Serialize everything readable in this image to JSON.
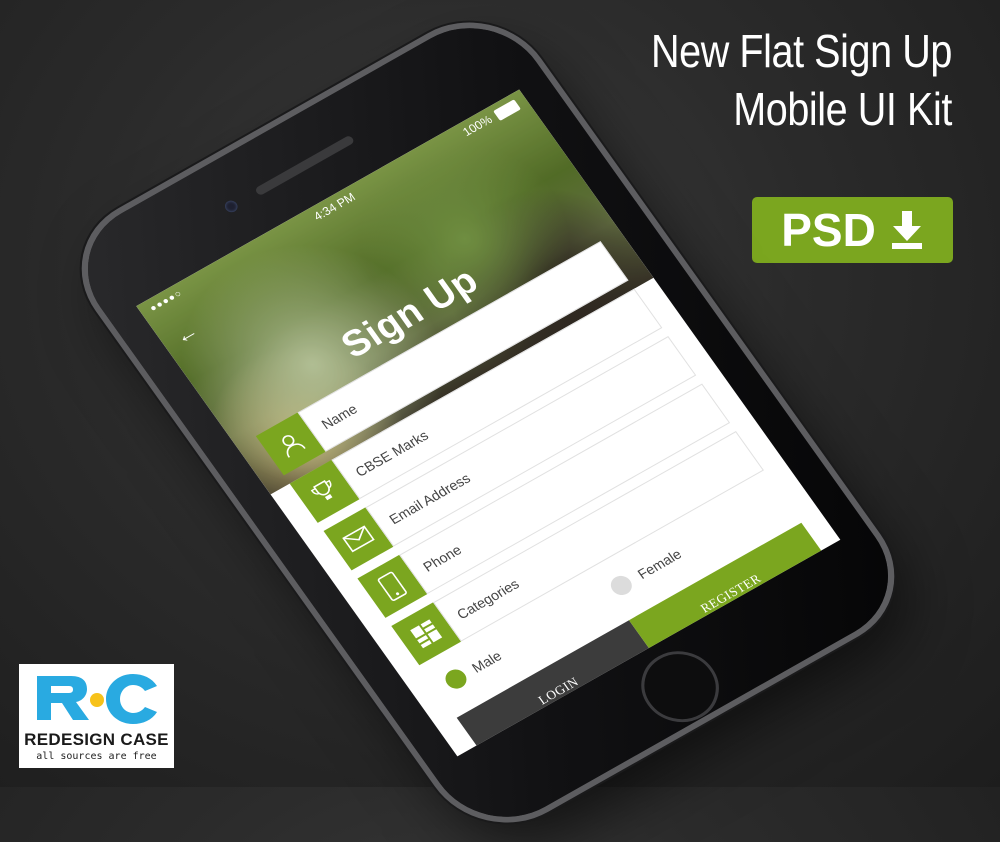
{
  "banner": {
    "headline_line1": "New Flat Sign Up",
    "headline_line2": "Mobile UI Kit",
    "psd_label": "PSD",
    "accent_color": "#7ba61f"
  },
  "status_bar": {
    "signal": "●●●●○",
    "time": "4:34 PM",
    "battery": "100%"
  },
  "screen": {
    "title": "Sign Up",
    "back_icon": "←",
    "fields": [
      {
        "label": "Name",
        "icon": "user-icon"
      },
      {
        "label": "CBSE Marks",
        "icon": "trophy-icon"
      },
      {
        "label": "Email Address",
        "icon": "envelope-icon"
      },
      {
        "label": "Phone",
        "icon": "phone-icon"
      },
      {
        "label": "Categories",
        "icon": "grid-icon"
      }
    ],
    "gender": {
      "male": "Male",
      "female": "Female",
      "selected": "Male"
    },
    "login_label": "LOGIN",
    "register_label": "REGISTER"
  },
  "logo": {
    "mark": "R●C",
    "name": "REDESIGN CASE",
    "tagline": "all sources are free"
  }
}
